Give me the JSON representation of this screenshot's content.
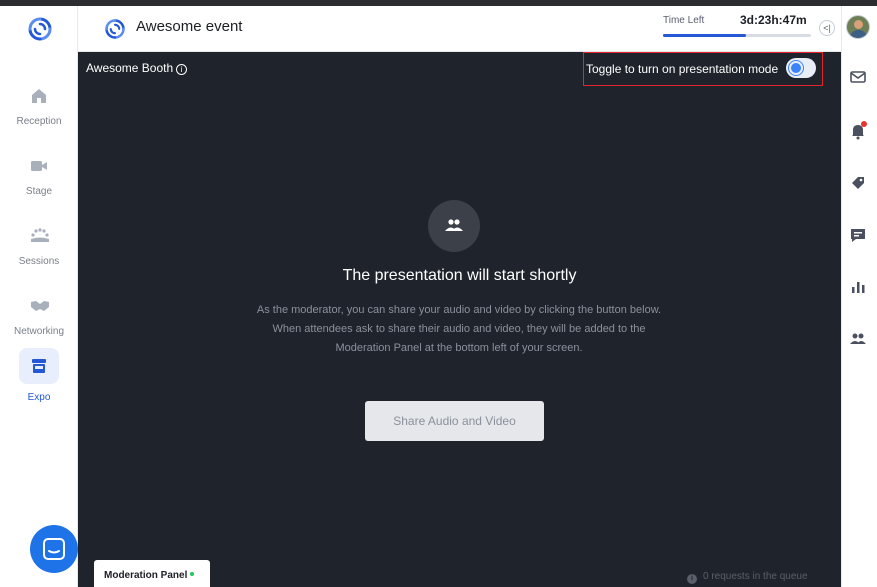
{
  "header": {
    "event_title": "Awesome event",
    "time_left_label": "Time Left",
    "time_left_value": "3d:23h:47m",
    "time_left_progress": 0.56,
    "collapse_glyph": "<|"
  },
  "sidebar": {
    "items": [
      {
        "label": "Reception",
        "icon": "home-icon",
        "active": false
      },
      {
        "label": "Stage",
        "icon": "video-camera-icon",
        "active": false
      },
      {
        "label": "Sessions",
        "icon": "audience-icon",
        "active": false
      },
      {
        "label": "Networking",
        "icon": "handshake-icon",
        "active": false
      },
      {
        "label": "Expo",
        "icon": "storefront-icon",
        "active": true
      }
    ]
  },
  "right_sidebar": {
    "icons": [
      "inbox-icon",
      "bell-icon",
      "ticket-icon",
      "chat-icon",
      "poll-icon",
      "people-icon"
    ],
    "bell_has_notification": true
  },
  "stage": {
    "booth_title": "Awesome Booth",
    "info_glyph": "i",
    "toggle_label": "Toggle to turn on presentation mode",
    "toggle_on": false,
    "presentation_title": "The presentation will start shortly",
    "presentation_description": "As the moderator, you can share your audio and video by clicking the button below. When attendees ask to share their audio and video, they will be added to the Moderation Panel at the bottom left of your screen.",
    "share_button_label": "Share Audio and Video",
    "moderation_panel_label": "Moderation Panel",
    "queue_text": "0 requests in the queue"
  },
  "colors": {
    "accent": "#2458d6",
    "stage_bg": "#1f232b",
    "highlight_border": "#e3242b",
    "chat_launcher": "#1f73e8"
  }
}
